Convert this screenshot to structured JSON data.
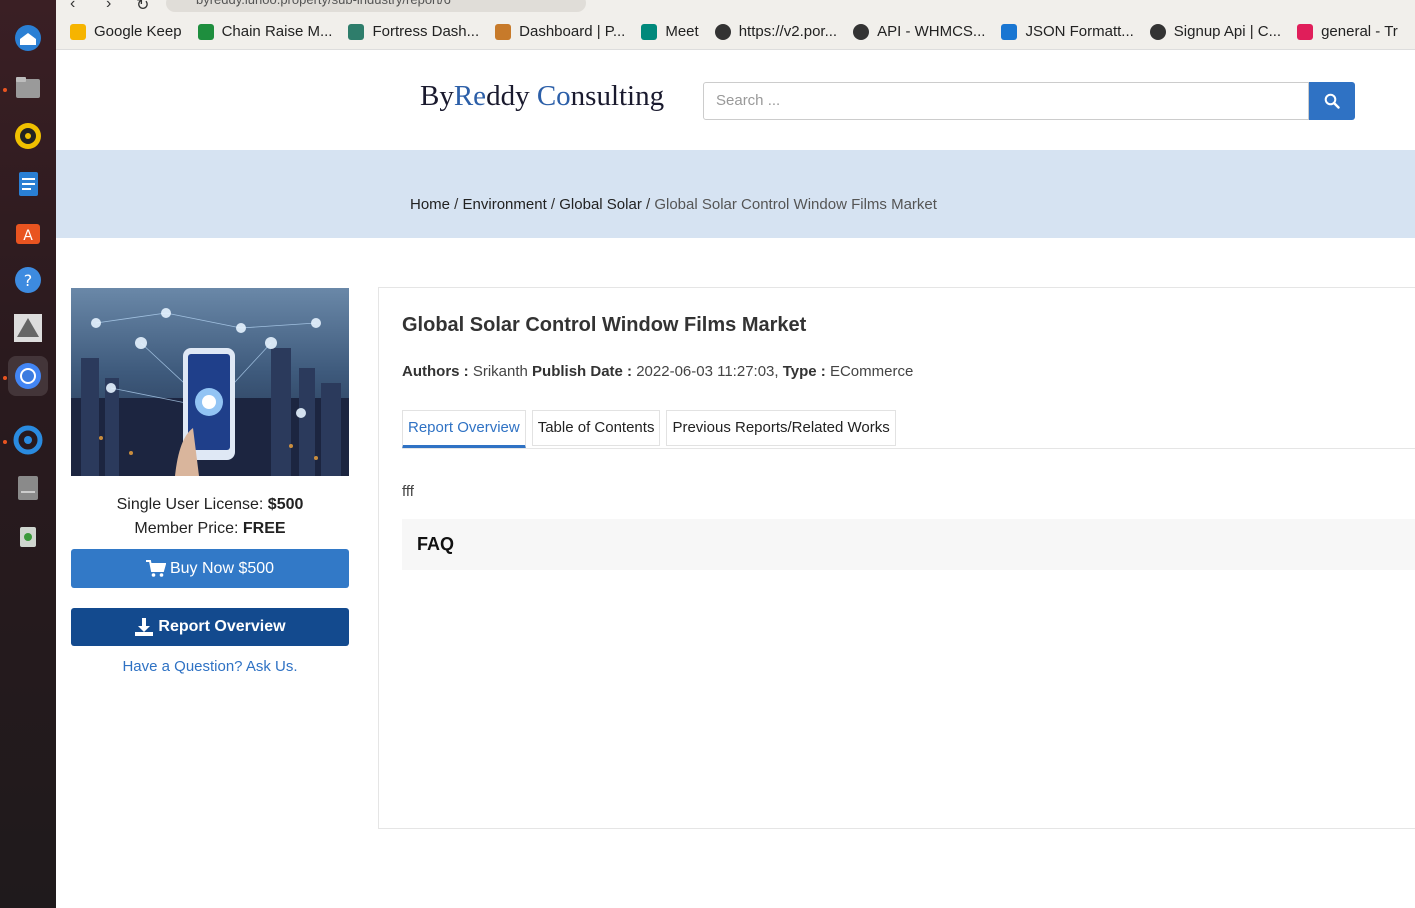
{
  "browser": {
    "url": "byreddy.lunoo.property/sub-industry/report/6",
    "bookmarks": [
      {
        "label": "Google Keep",
        "icon": "keep-icon",
        "color": "#f6b400"
      },
      {
        "label": "Chain Raise M...",
        "icon": "sheets-icon",
        "color": "#1e8e3e"
      },
      {
        "label": "Fortress Dash...",
        "icon": "fortress-icon",
        "color": "#2e7d6b"
      },
      {
        "label": "Dashboard | P...",
        "icon": "dashboard-icon",
        "color": "#c77a2a"
      },
      {
        "label": "Meet",
        "icon": "meet-icon",
        "color": "#00897b"
      },
      {
        "label": "https://v2.por...",
        "icon": "globe-icon",
        "color": "#333333"
      },
      {
        "label": "API - WHMCS...",
        "icon": "globe-icon",
        "color": "#333333"
      },
      {
        "label": "JSON Formatt...",
        "icon": "check-icon",
        "color": "#1976d2"
      },
      {
        "label": "Signup Api | C...",
        "icon": "globe-icon",
        "color": "#333333"
      },
      {
        "label": "general - Tr",
        "icon": "slack-icon",
        "color": "#e01e5a"
      }
    ]
  },
  "header": {
    "logo_part1": "By",
    "logo_part2": "Re",
    "logo_part3": "ddy ",
    "logo_part4": "Co",
    "logo_part5": "nsulting",
    "search_placeholder": "Search ..."
  },
  "breadcrumb": {
    "home": "Home",
    "sep": " / ",
    "level1": "Environment",
    "level2": "Global Solar",
    "current": "Global Solar Control Window Films Market"
  },
  "sidebar": {
    "license_label": "Single User License: ",
    "license_price": "$500",
    "member_label": "Member Price: ",
    "member_price": "FREE",
    "buy_label": "Buy Now $500",
    "overview_label": "Report Overview",
    "ask_label": "Have a Question? Ask Us."
  },
  "report": {
    "title": "Global Solar Control Window Films Market",
    "authors_label": "Authors : ",
    "authors_value": "Srikanth",
    "publish_label": "Publish Date : ",
    "publish_value": "2022-06-03 11:27:03,",
    "type_label": "Type : ",
    "type_value": "ECommerce",
    "tabs": [
      "Report Overview",
      "Table of Contents",
      "Previous Reports/Related Works"
    ],
    "body": "fff",
    "faq_label": "FAQ"
  },
  "colors": {
    "accent": "#2f72c4",
    "dark_button": "#134a8e",
    "breadcrumb_band": "#d6e3f2"
  }
}
